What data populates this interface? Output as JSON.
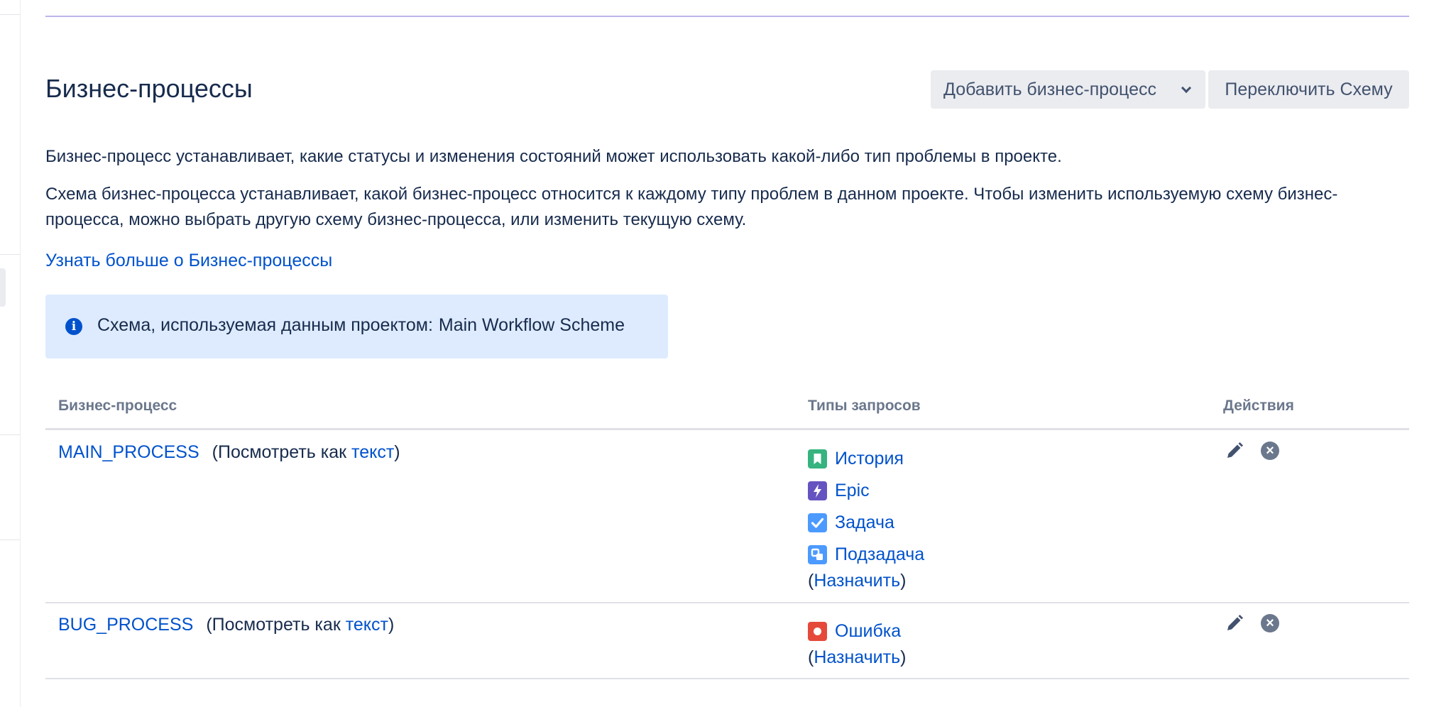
{
  "header": {
    "title": "Бизнес-процессы",
    "add_button": "Добавить бизнес-процесс",
    "switch_button": "Переключить Схему"
  },
  "description": {
    "p1": "Бизнес-процесс устанавливает, какие статусы и изменения состояний может использовать какой-либо тип проблемы в проекте.",
    "p2": "Схема бизнес-процесса устанавливает, какой бизнес-процесс относится к каждому типу проблем в данном проекте. Чтобы изменить используемую схему бизнес-процесса, можно выбрать другую схему бизнес-процесса, или изменить текущую схему.",
    "learn_more": "Узнать больше о Бизнес-процессы"
  },
  "info": {
    "label": "Схема, используемая данным проектом:",
    "scheme": "Main Workflow Scheme"
  },
  "table": {
    "headers": {
      "workflow": "Бизнес-процесс",
      "issue_types": "Типы запросов",
      "actions": "Действия"
    },
    "view_prefix": "(Посмотреть как ",
    "view_link": "текст",
    "view_suffix": ")",
    "assign_open": "(",
    "assign_link": "Назначить",
    "assign_close": ")",
    "rows": [
      {
        "name": "MAIN_PROCESS",
        "types": [
          {
            "label": "История",
            "icon": "story-icon",
            "color": "#36B37E"
          },
          {
            "label": "Epic",
            "icon": "epic-icon",
            "color": "#6554C0"
          },
          {
            "label": "Задача",
            "icon": "task-icon",
            "color": "#4C9AFF"
          },
          {
            "label": "Подзадача",
            "icon": "subtask-icon",
            "color": "#4C9AFF"
          }
        ]
      },
      {
        "name": "BUG_PROCESS",
        "types": [
          {
            "label": "Ошибка",
            "icon": "bug-icon",
            "color": "#E5493A"
          }
        ]
      }
    ]
  }
}
